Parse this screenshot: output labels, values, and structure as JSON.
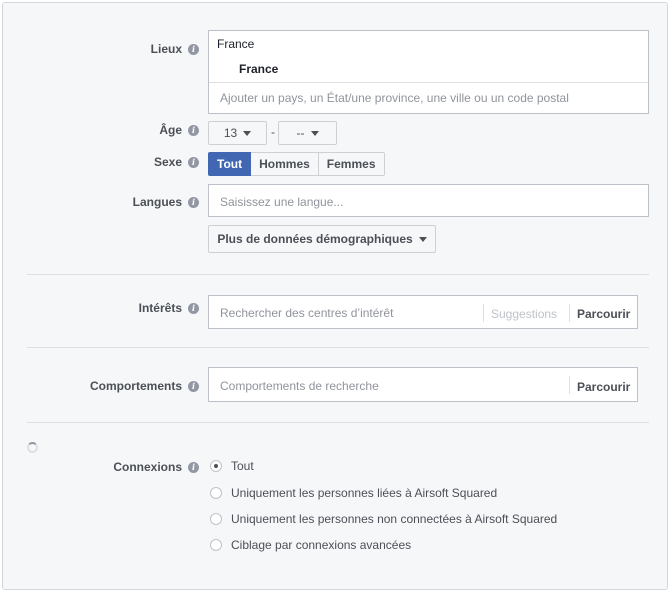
{
  "lieux": {
    "label": "Lieux",
    "header": "France",
    "selected": "France",
    "placeholder": "Ajouter un pays, un État/une province, une ville ou un code postal"
  },
  "age": {
    "label": "Âge",
    "min": "13",
    "separator": "-",
    "max": "--"
  },
  "sexe": {
    "label": "Sexe",
    "options": [
      "Tout",
      "Hommes",
      "Femmes"
    ],
    "selected": "Tout"
  },
  "langues": {
    "label": "Langues",
    "placeholder": "Saisissez une langue..."
  },
  "demographics_button": "Plus de données démographiques",
  "interets": {
    "label": "Intérêts",
    "placeholder": "Rechercher des centres d’intérêt",
    "suggestions": "Suggestions",
    "browse": "Parcourir"
  },
  "comportements": {
    "label": "Comportements",
    "placeholder": "Comportements de recherche",
    "browse": "Parcourir"
  },
  "connexions": {
    "label": "Connexions",
    "options": [
      "Tout",
      "Uniquement les personnes liées à Airsoft Squared",
      "Uniquement les personnes non connectées à Airsoft Squared",
      "Ciblage par connexions avancées"
    ],
    "selected_index": 0
  },
  "icons": {
    "info": "info-icon",
    "caret": "caret-down-icon",
    "loading": "loading-spinner-icon"
  },
  "colors": {
    "accent": "#4267b2",
    "background": "#f6f7f9",
    "border": "#bdc1c9"
  }
}
